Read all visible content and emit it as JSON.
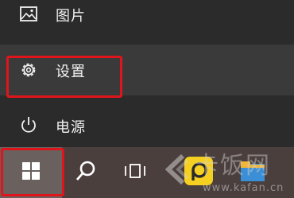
{
  "start_menu": {
    "items": [
      {
        "label": "图片",
        "icon": "pictures-icon"
      },
      {
        "label": "设置",
        "icon": "gear-icon"
      },
      {
        "label": "电源",
        "icon": "power-icon"
      }
    ]
  },
  "taskbar": {
    "buttons": [
      "windows-start-icon",
      "search-icon",
      "task-view-icon",
      "yellow-app-icon",
      "blue-app-icon"
    ]
  },
  "watermark": {
    "title": "卡饭网",
    "url": "www.kafan.cn"
  },
  "colors": {
    "highlight": "#e0151b",
    "menu_bg": "#2b2b2b",
    "selected_bg": "#3a3a3a",
    "taskbar_bg": "#4a3f3c"
  }
}
